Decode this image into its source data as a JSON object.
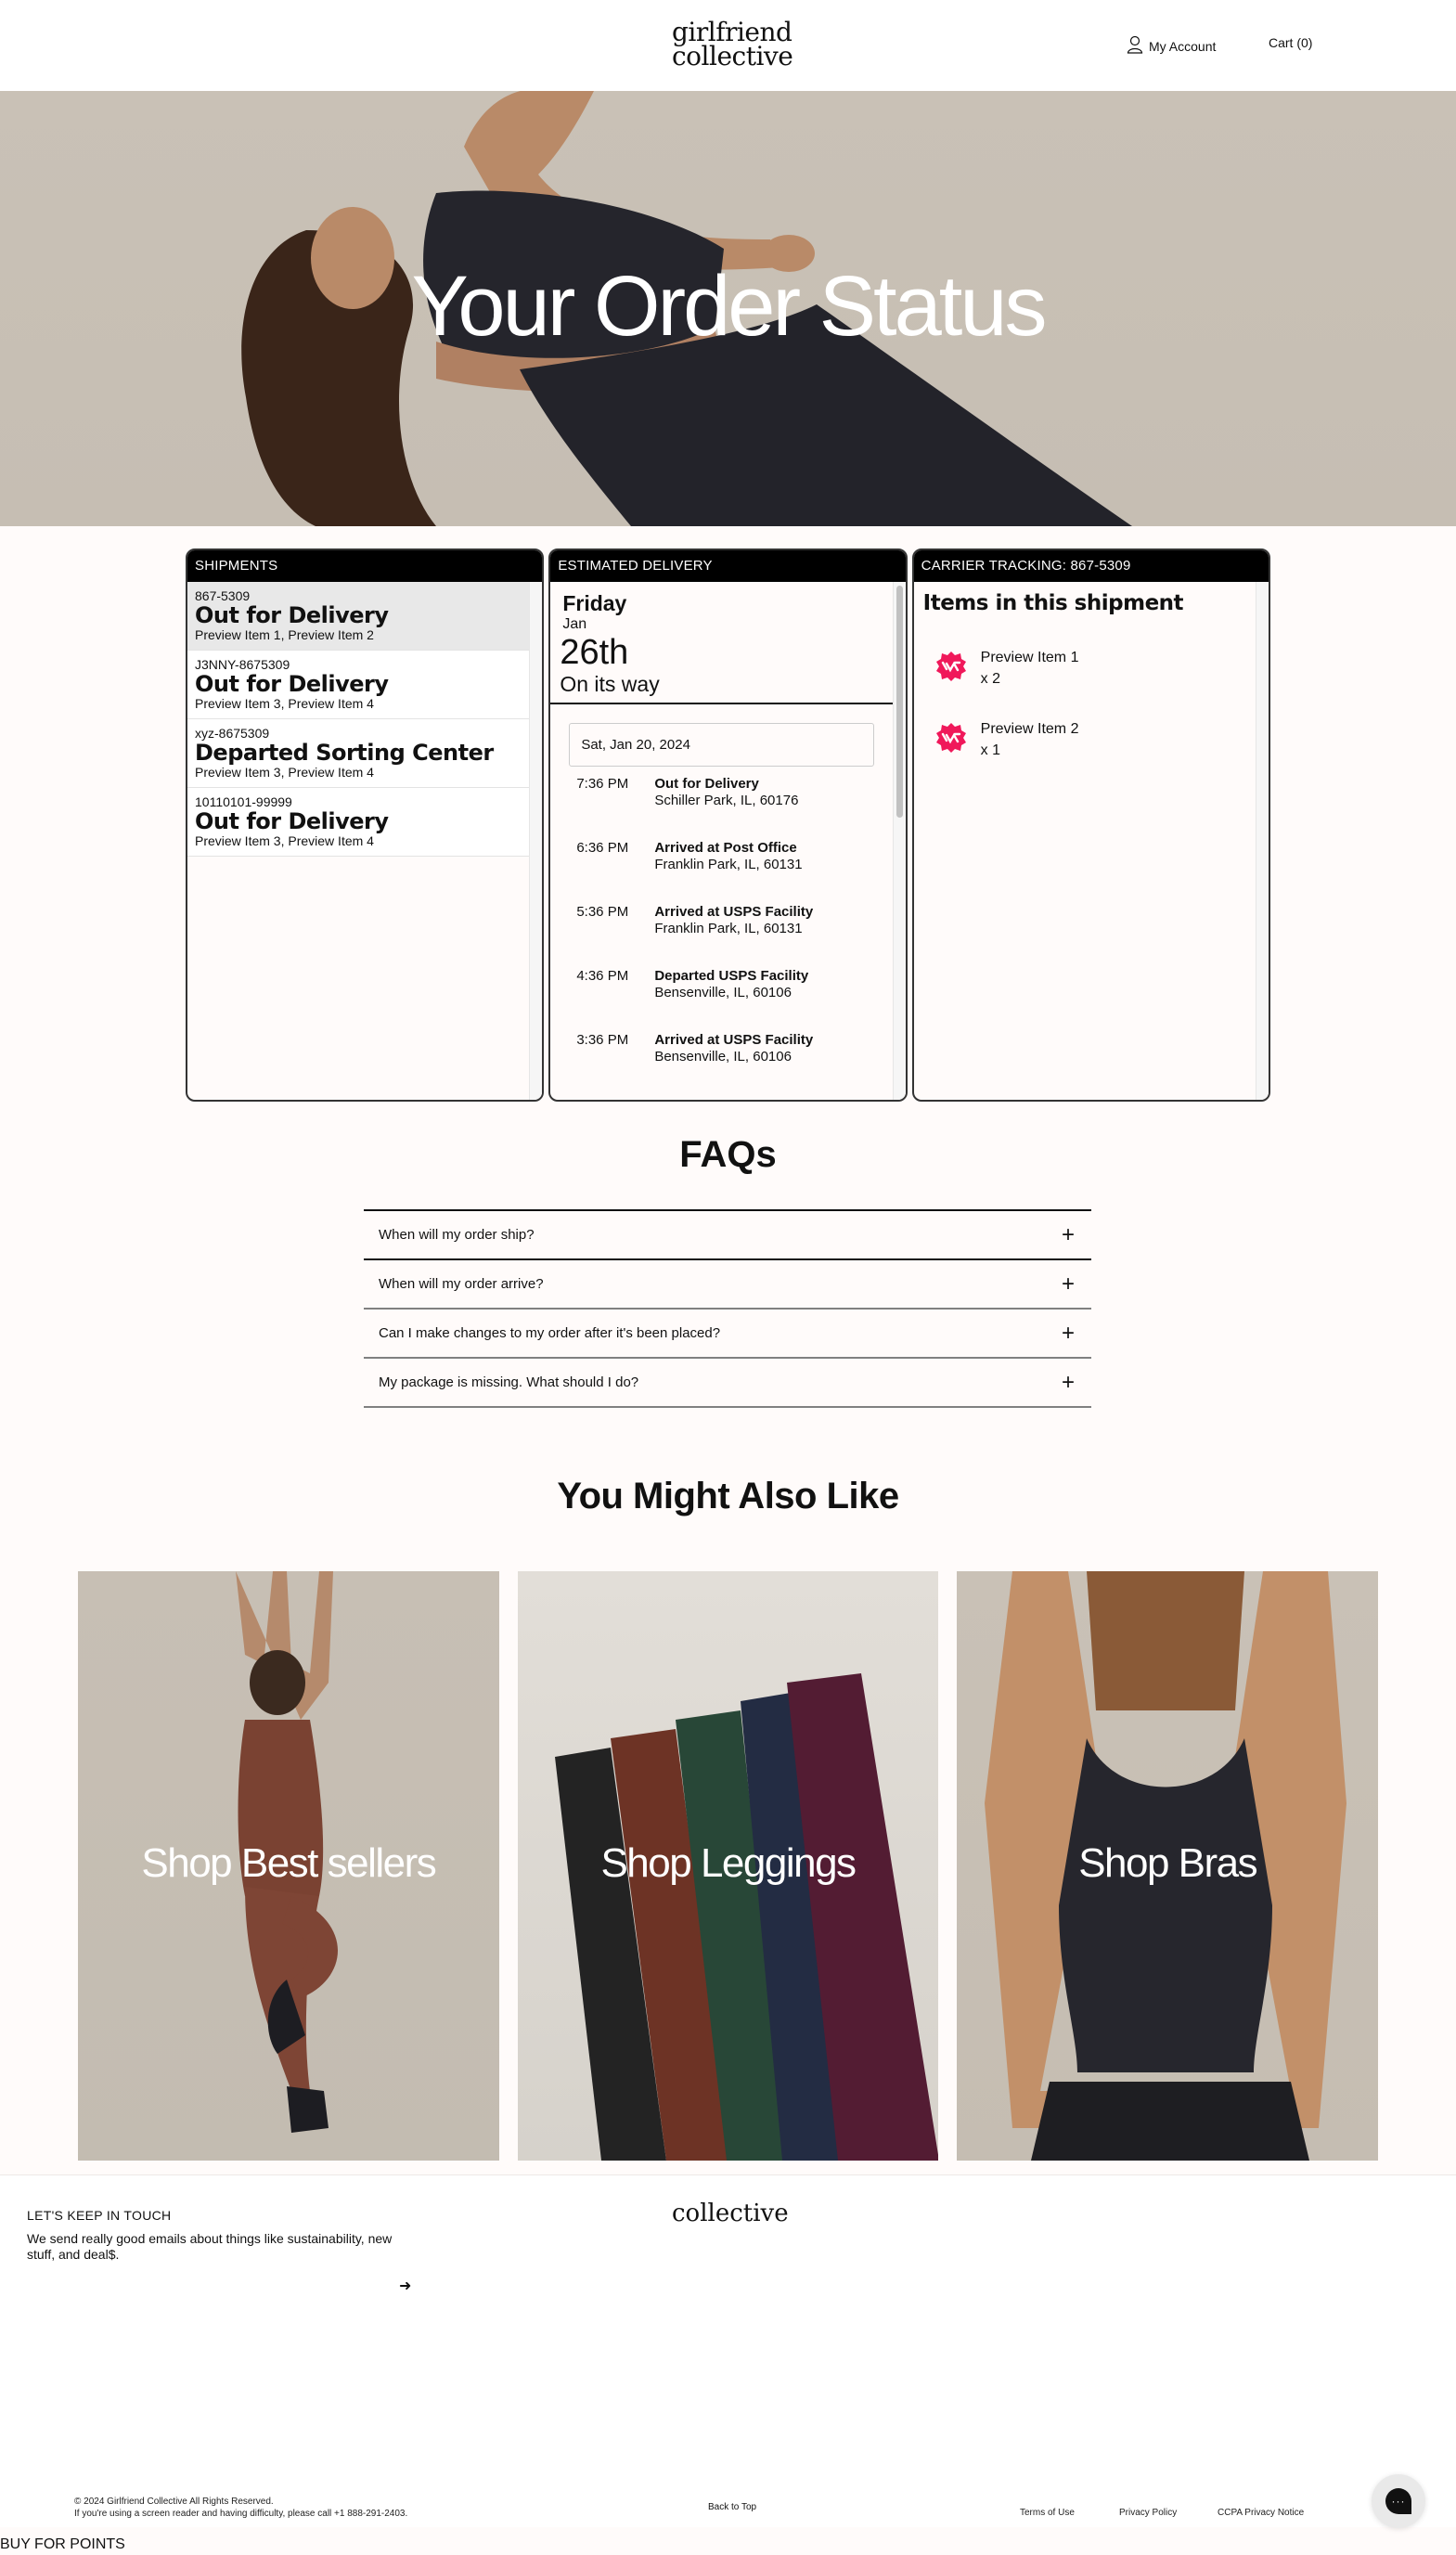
{
  "header": {
    "logo_line1": "girlfriend",
    "logo_line2": "collective",
    "account_label": "My Account",
    "cart_label": "Cart (0)"
  },
  "hero": {
    "title": "Your Order Status"
  },
  "shipments": {
    "header": "SHIPMENTS",
    "items": [
      {
        "id": "867-5309",
        "status": "Out for Delivery",
        "items": "Preview Item 1, Preview Item 2",
        "selected": true
      },
      {
        "id": "J3NNY-8675309",
        "status": "Out for Delivery",
        "items": "Preview Item 3, Preview Item 4",
        "selected": false
      },
      {
        "id": "xyz-8675309",
        "status": "Departed Sorting Center",
        "items": "Preview Item 3, Preview Item 4",
        "selected": false
      },
      {
        "id": "10110101-99999",
        "status": "Out for Delivery",
        "items": "Preview Item 3, Preview Item 4",
        "selected": false
      }
    ]
  },
  "estimated": {
    "header": "ESTIMATED DELIVERY",
    "day": "Friday",
    "month": "Jan",
    "date": "26th",
    "note": "On its way",
    "date_group": "Sat, Jan 20, 2024",
    "events": [
      {
        "time": "7:36 PM",
        "title": "Out for Delivery",
        "location": "Schiller Park, IL, 60176"
      },
      {
        "time": "6:36 PM",
        "title": "Arrived at Post Office",
        "location": "Franklin Park, IL, 60131"
      },
      {
        "time": "5:36 PM",
        "title": "Arrived at USPS Facility",
        "location": "Franklin Park, IL, 60131"
      },
      {
        "time": "4:36 PM",
        "title": "Departed USPS Facility",
        "location": "Bensenville, IL, 60106"
      },
      {
        "time": "3:36 PM",
        "title": "Arrived at USPS Facility",
        "location": "Bensenville, IL, 60106"
      }
    ]
  },
  "carrier": {
    "header": "CARRIER TRACKING: 867-5309",
    "title": "Items in this shipment",
    "items": [
      {
        "name": "Preview Item 1",
        "qty": "x 2"
      },
      {
        "name": "Preview Item 2",
        "qty": "x 1"
      }
    ],
    "badge_color": "#f0185a"
  },
  "faq": {
    "title": "FAQs",
    "questions": [
      "When will my order ship?",
      "When will my order arrive?",
      "Can I make changes to my order after it's been placed?",
      "My package is missing. What should I do?"
    ]
  },
  "also_like": {
    "title": "You Might Also Like",
    "cards": [
      {
        "label": "Shop Best sellers"
      },
      {
        "label": "Shop Leggings"
      },
      {
        "label": "Shop Bras"
      }
    ]
  },
  "footer": {
    "newsletter_heading": "LET'S KEEP IN TOUCH",
    "newsletter_text": "We send really good emails about things like sustainability, new stuff, and deal$.",
    "submit_icon": "arrow-right",
    "logo": "collective",
    "copyright": "© 2024 Girlfriend Collective All Rights Reserved.",
    "accessibility": "If you're using a screen reader and having difficulty, please call +1 888-291-2403.",
    "back_to_top": "Back to Top",
    "legal_links": [
      "Terms of Use",
      "Privacy Policy",
      "CCPA Privacy Notice"
    ],
    "buy_for_points": "BUY FOR POINTS"
  }
}
